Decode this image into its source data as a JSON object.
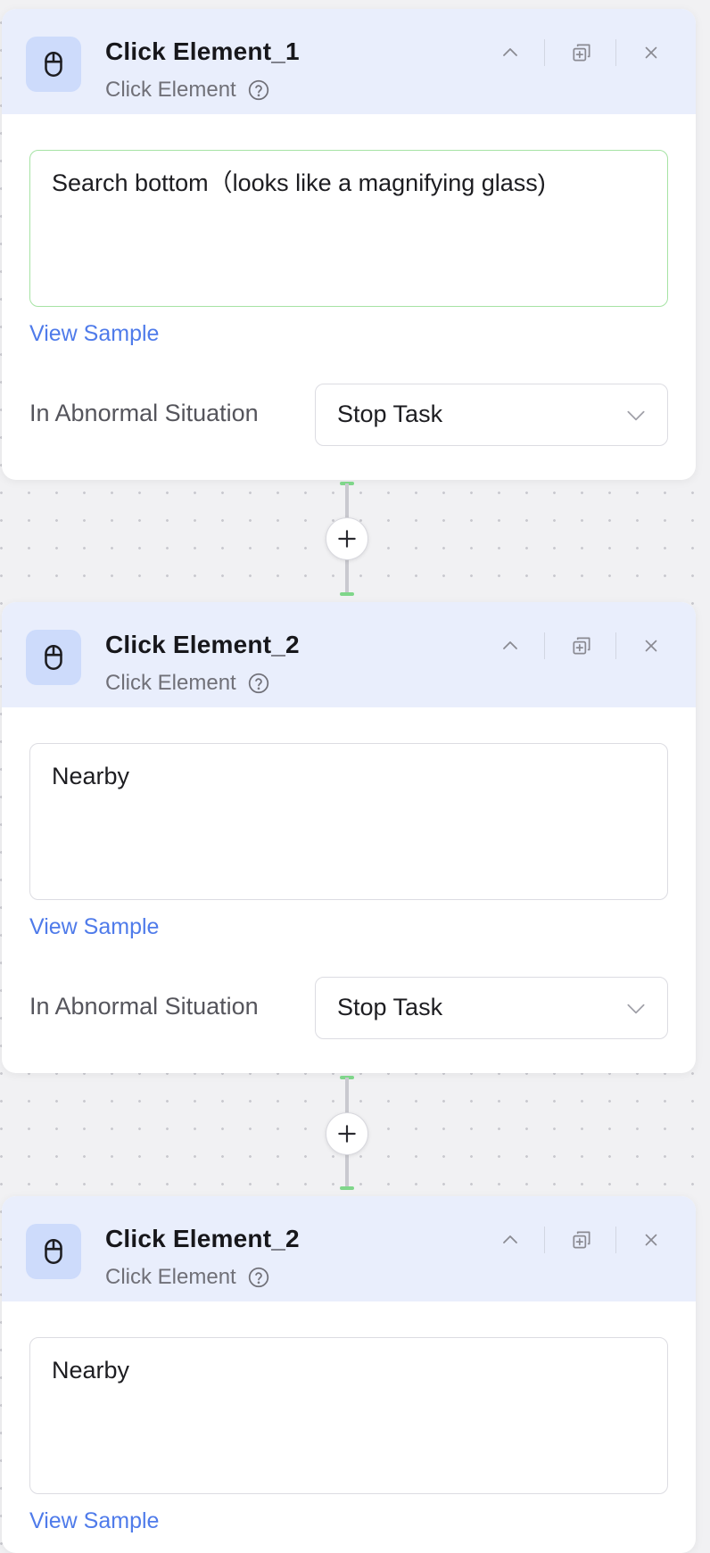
{
  "nodes": [
    {
      "title": "Click Element_1",
      "subtitle": "Click Element",
      "text": "Search bottom（looks like a magnifying glass)",
      "view_sample": "View Sample",
      "abnormal_label": "In Abnormal Situation",
      "abnormal_value": "Stop Task"
    },
    {
      "title": "Click Element_2",
      "subtitle": "Click Element",
      "text": "Nearby",
      "view_sample": "View Sample",
      "abnormal_label": "In Abnormal Situation",
      "abnormal_value": "Stop Task"
    },
    {
      "title": "Click Element_2",
      "subtitle": "Click Element",
      "text": "Nearby",
      "view_sample": "View Sample"
    }
  ],
  "icons": {
    "node": "mouse-icon",
    "help": "question-circle-icon",
    "collapse": "chevron-up-icon",
    "copy": "copy-add-icon",
    "close": "close-icon",
    "dropdown": "chevron-down-icon",
    "add": "plus-icon"
  },
  "colors": {
    "header_bg": "#e9eefc",
    "accent": "#4f7bea",
    "connector_cap": "#7fd68a",
    "active_border": "#a6e3a4"
  }
}
